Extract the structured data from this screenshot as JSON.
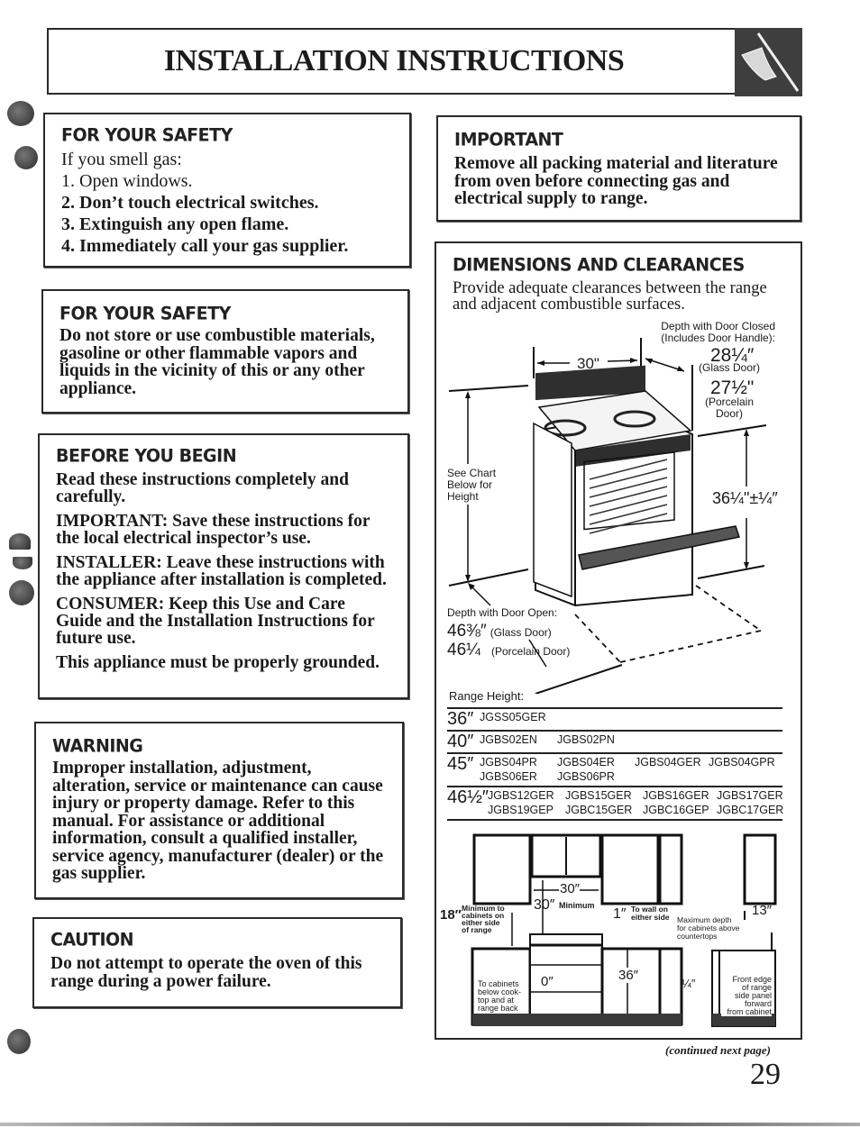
{
  "header": {
    "title": "INSTALLATION INSTRUCTIONS",
    "tab_icon": "hand-with-wrench-icon"
  },
  "safety_gas": {
    "title": "FOR YOUR SAFETY",
    "intro": "If you smell gas:",
    "items": [
      "1. Open windows.",
      "2. Don’t touch electrical switches.",
      "3. Extinguish any open flame.",
      "4. Immediately call your gas supplier."
    ]
  },
  "safety_combustible": {
    "title": "FOR YOUR SAFETY",
    "text": "Do not store or use combustible materials, gasoline or other flammable vapors and liquids in the vicinity of this or any other appliance."
  },
  "before_you_begin": {
    "title": "BEFORE YOU BEGIN",
    "paragraphs": [
      "Read these instructions completely and carefully.",
      "IMPORTANT: Save these instructions for the local electrical inspector’s use.",
      "INSTALLER: Leave these instructions with the appliance after installation is completed.",
      "CONSUMER: Keep this Use and Care Guide and the Installation Instructions for future use.",
      "This appliance must be properly grounded."
    ]
  },
  "warning": {
    "title": "WARNING",
    "text": "Improper installation, adjustment, alteration, service or maintenance can cause injury or property damage. Refer to this manual. For assistance or additional information, consult a qualified installer, service agency, manufacturer (dealer) or the gas supplier."
  },
  "caution": {
    "title": "CAUTION",
    "text": "Do not attempt to operate the oven of this range during a power failure."
  },
  "important": {
    "title": "IMPORTANT",
    "text": "Remove all packing material and literature from oven before connecting gas and electrical supply to range."
  },
  "dimensions": {
    "title": "DIMENSIONS AND CLEARANCES",
    "intro": "Provide adequate clearances between the range and adjacent combustible surfaces.",
    "depth_closed_label_1": "Depth with Door Closed",
    "depth_closed_label_2": "(Includes Door Handle):",
    "depth_glass_value": "28¼″",
    "depth_glass_label": "(Glass Door)",
    "depth_porcelain_value": "27½\"",
    "depth_porcelain_label_1": "(Porcelain",
    "depth_porcelain_label_2": "Door)",
    "width_value": "30\"",
    "height_value": "36¼\"±¼″",
    "see_chart_1": "See Chart",
    "see_chart_2": "Below for",
    "see_chart_3": "Height",
    "depth_open_label": "Depth with Door Open:",
    "depth_open_glass_value": "46⅜″",
    "depth_open_glass_label": "(Glass Door)",
    "depth_open_porcelain_value": "46¼",
    "depth_open_porcelain_label": "(Porcelain Door)"
  },
  "range_height": {
    "label": "Range Height:",
    "rows": [
      {
        "height": "36″",
        "models": [
          "JGSS05GER"
        ]
      },
      {
        "height": "40″",
        "models": [
          "JGBS02EN",
          "JGBS02PN"
        ]
      },
      {
        "height": "45″",
        "models": [
          "JGBS04PR",
          "JGBS04ER",
          "JGBS04GER",
          "JGBS04GPR",
          "JGBS06ER",
          "JGBS06PR"
        ]
      },
      {
        "height": "46½″",
        "models": [
          "JGBS12GER",
          "JGBS15GER",
          "JGBS16GER",
          "JGBS17GER",
          "JGBS19GEP",
          "JGBC15GER",
          "JGBC16GEP",
          "JGBC17GER"
        ]
      }
    ]
  },
  "clearance_diagram": {
    "side_value": "18″",
    "side_label_1": "Minimum to",
    "side_label_2": "cabinets on",
    "side_label_3": "either side",
    "side_label_4": "of range",
    "width_value": "30″",
    "top_value": "30″",
    "top_label": "Minimum",
    "wall_value": "1″",
    "wall_label_1": "To wall on",
    "wall_label_2": "either side",
    "max_depth_label_1": "Maximum depth",
    "max_depth_label_2": "for cabinets above",
    "max_depth_label_3": "countertops",
    "max_depth_value": "13″",
    "back_value": "0″",
    "back_label_1": "To cabinets",
    "back_label_2": "below cook-",
    "back_label_3": "top and at",
    "back_label_4": "range back",
    "counter_value": "36″",
    "front_value": "¼″",
    "front_label_1": "Front edge",
    "front_label_2": "of range",
    "front_label_3": "side panel",
    "front_label_4": "forward",
    "front_label_5": "from cabinet"
  },
  "footer": {
    "continued": "(continued next page)",
    "page_number": "29"
  }
}
